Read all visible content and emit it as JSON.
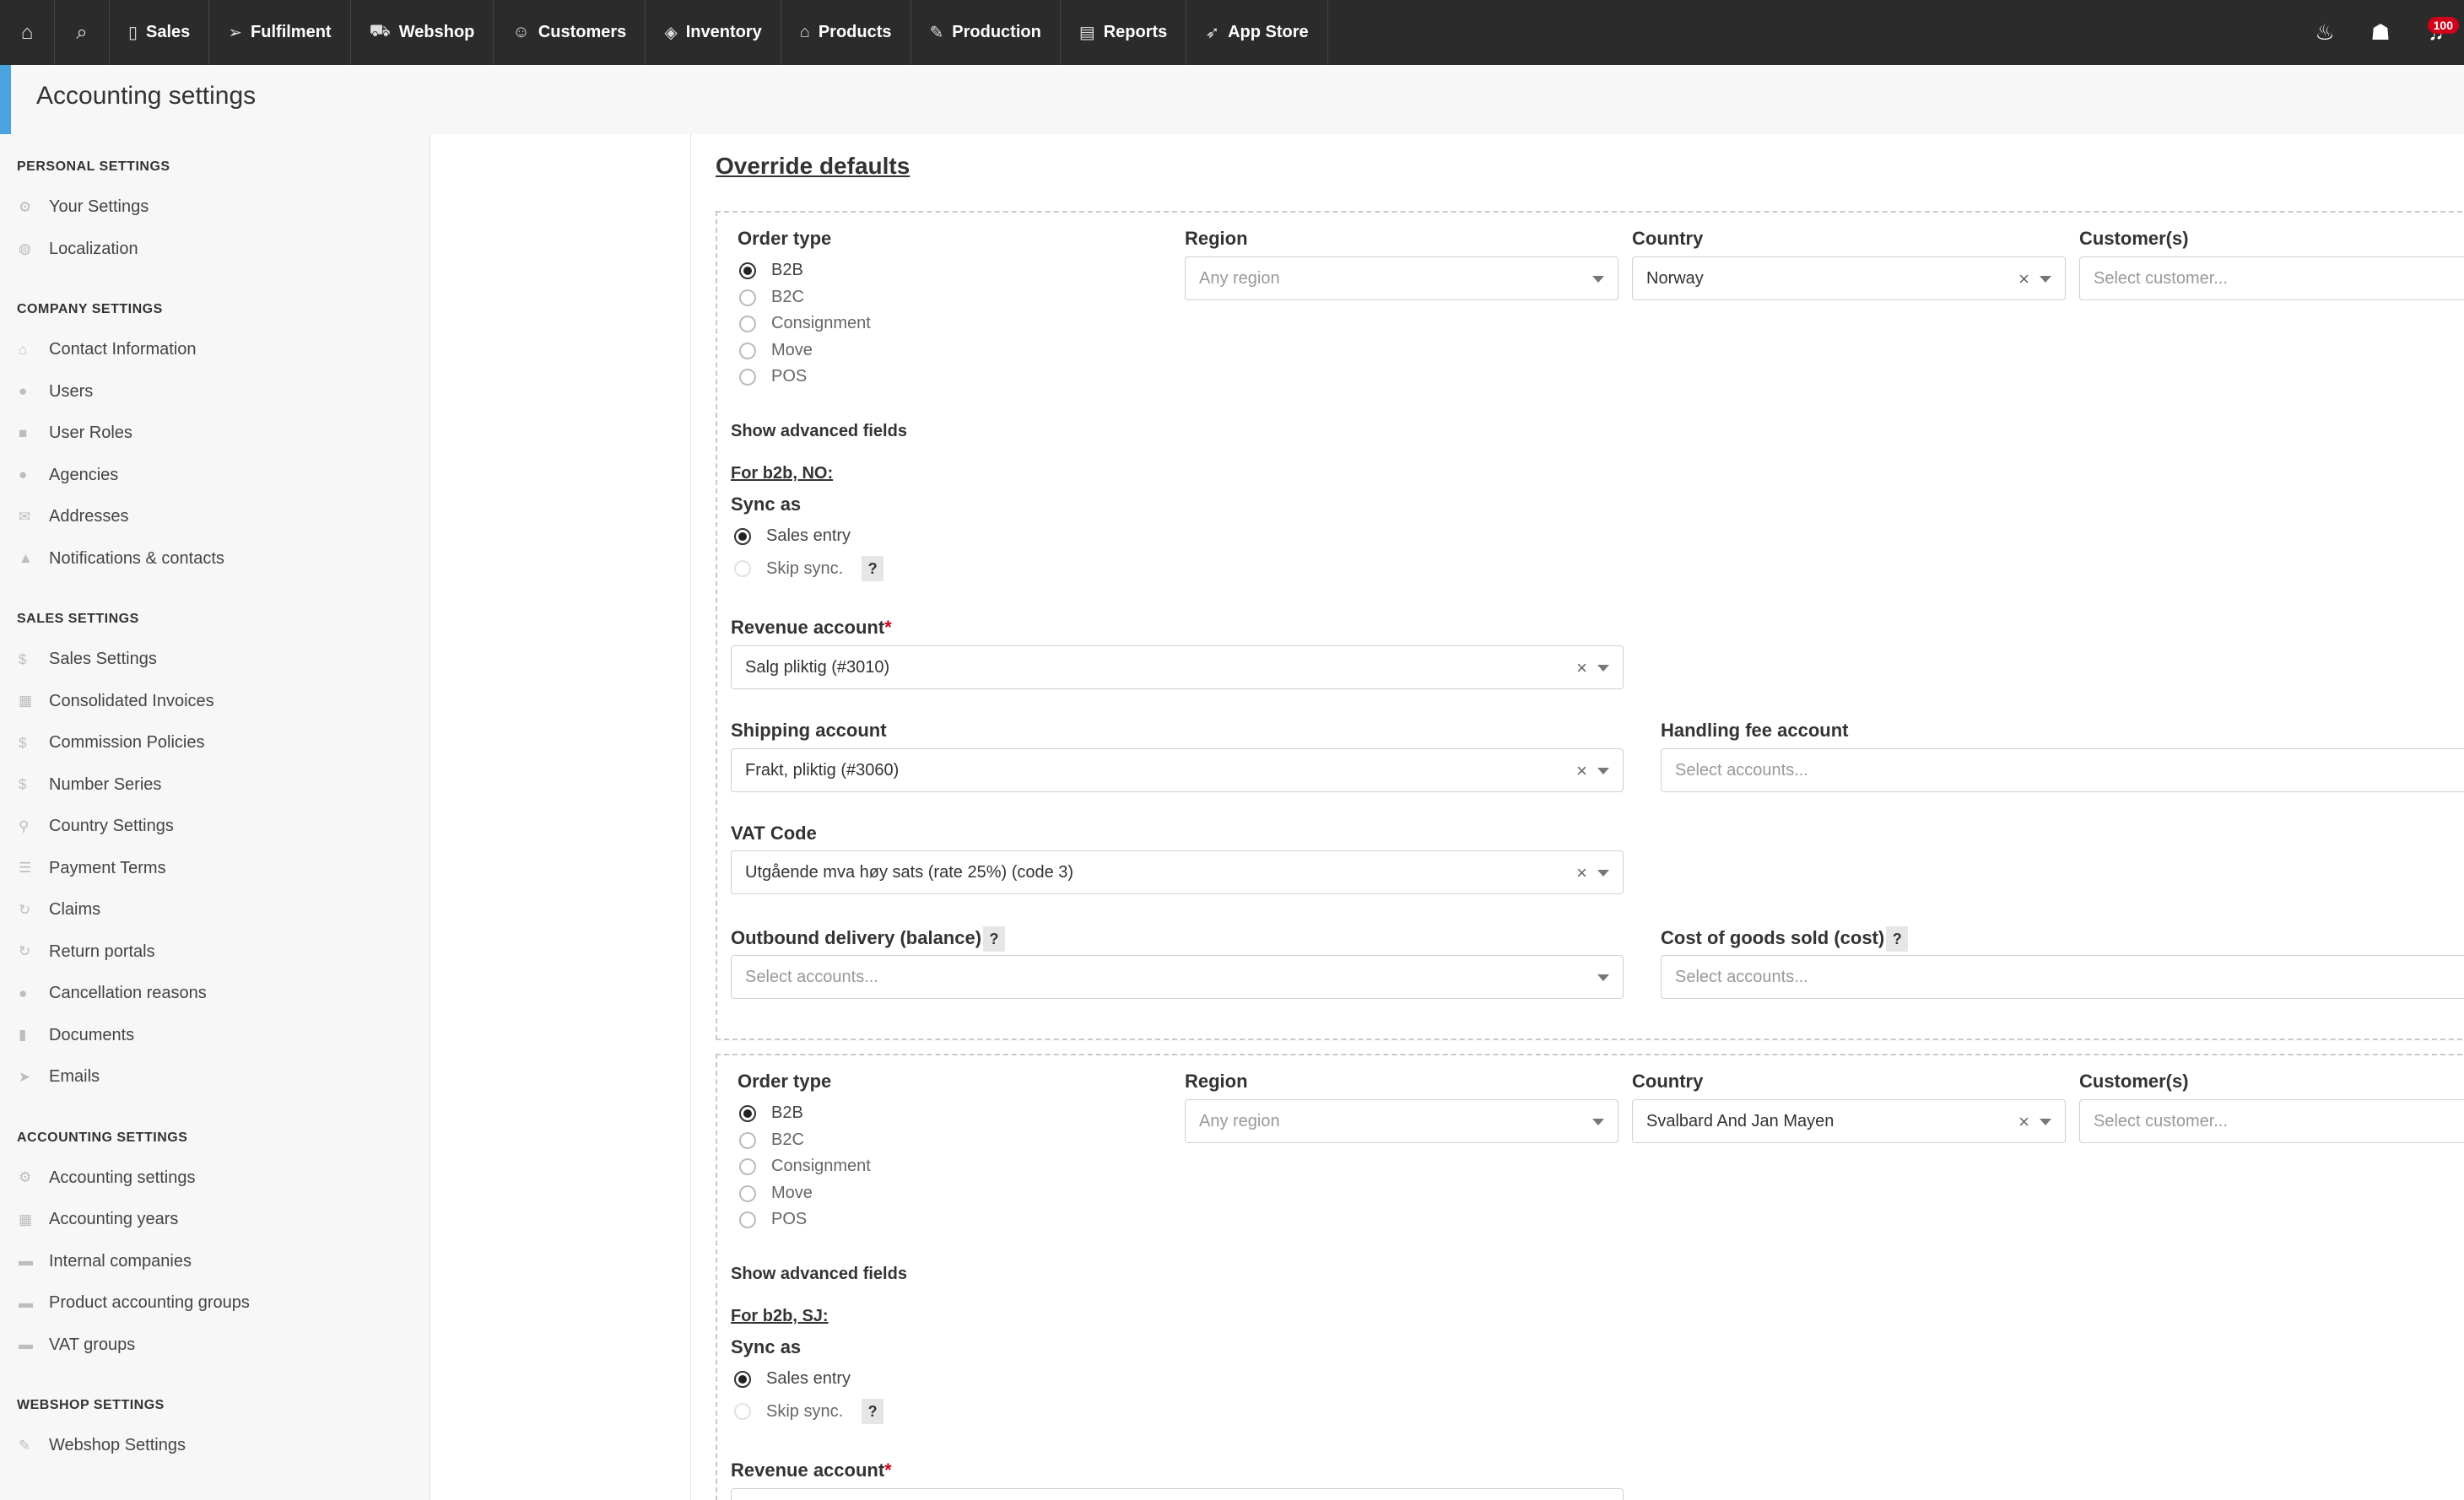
{
  "nav": {
    "items": [
      {
        "label": "Sales",
        "icon": "file-icon"
      },
      {
        "label": "Fulfilment",
        "icon": "paper-plane-icon"
      },
      {
        "label": "Webshop",
        "icon": "cart-icon"
      },
      {
        "label": "Customers",
        "icon": "users-icon"
      },
      {
        "label": "Inventory",
        "icon": "layers-icon"
      },
      {
        "label": "Products",
        "icon": "tag-icon"
      },
      {
        "label": "Production",
        "icon": "pencil-icon"
      },
      {
        "label": "Reports",
        "icon": "report-icon"
      },
      {
        "label": "App Store",
        "icon": "rocket-icon"
      }
    ],
    "notification_count": "100"
  },
  "page": {
    "title": "Accounting settings"
  },
  "sidebar": {
    "personal": {
      "heading": "PERSONAL SETTINGS",
      "items": [
        "Your Settings",
        "Localization"
      ]
    },
    "company": {
      "heading": "COMPANY SETTINGS",
      "items": [
        "Contact Information",
        "Users",
        "User Roles",
        "Agencies",
        "Addresses",
        "Notifications & contacts"
      ]
    },
    "sales": {
      "heading": "SALES SETTINGS",
      "items": [
        "Sales Settings",
        "Consolidated Invoices",
        "Commission Policies",
        "Number Series",
        "Country Settings",
        "Payment Terms",
        "Claims",
        "Return portals",
        "Cancellation reasons",
        "Documents",
        "Emails"
      ]
    },
    "accounting": {
      "heading": "ACCOUNTING SETTINGS",
      "items": [
        "Accounting settings",
        "Accounting years",
        "Internal companies",
        "Product accounting groups",
        "VAT groups"
      ]
    },
    "webshop": {
      "heading": "WEBSHOP SETTINGS",
      "items": [
        "Webshop Settings"
      ]
    }
  },
  "main": {
    "title": "Override defaults",
    "labels": {
      "order_type": "Order type",
      "region": "Region",
      "country": "Country",
      "customers": "Customer(s)",
      "show_advanced": "Show advanced fields",
      "sync_as": "Sync as",
      "revenue_account": "Revenue account",
      "required_mark": "*",
      "shipping_account": "Shipping account",
      "handling_fee_account": "Handling fee account",
      "vat_code": "VAT Code",
      "outbound_delivery": "Outbound delivery (balance)",
      "cogs": "Cost of goods sold (cost)",
      "help": "?"
    },
    "order_types": [
      "B2B",
      "B2C",
      "Consignment",
      "Move",
      "POS"
    ],
    "sync_options": [
      "Sales entry",
      "Skip sync."
    ],
    "placeholders": {
      "region": "Any region",
      "customer": "Select customer...",
      "accounts": "Select accounts..."
    },
    "blocks": [
      {
        "order_type_selected": "B2B",
        "country": "Norway",
        "for_heading": "For b2b, NO:",
        "sync_selected": "Sales entry",
        "revenue_account": "Salg pliktig (#3010)",
        "shipping_account": "Frakt, pliktig (#3060)",
        "vat_code": "Utgående mva høy sats (rate 25%) (code 3)"
      },
      {
        "order_type_selected": "B2B",
        "country": "Svalbard And Jan Mayen",
        "for_heading": "For b2b, SJ:",
        "sync_selected": "Sales entry"
      }
    ]
  }
}
